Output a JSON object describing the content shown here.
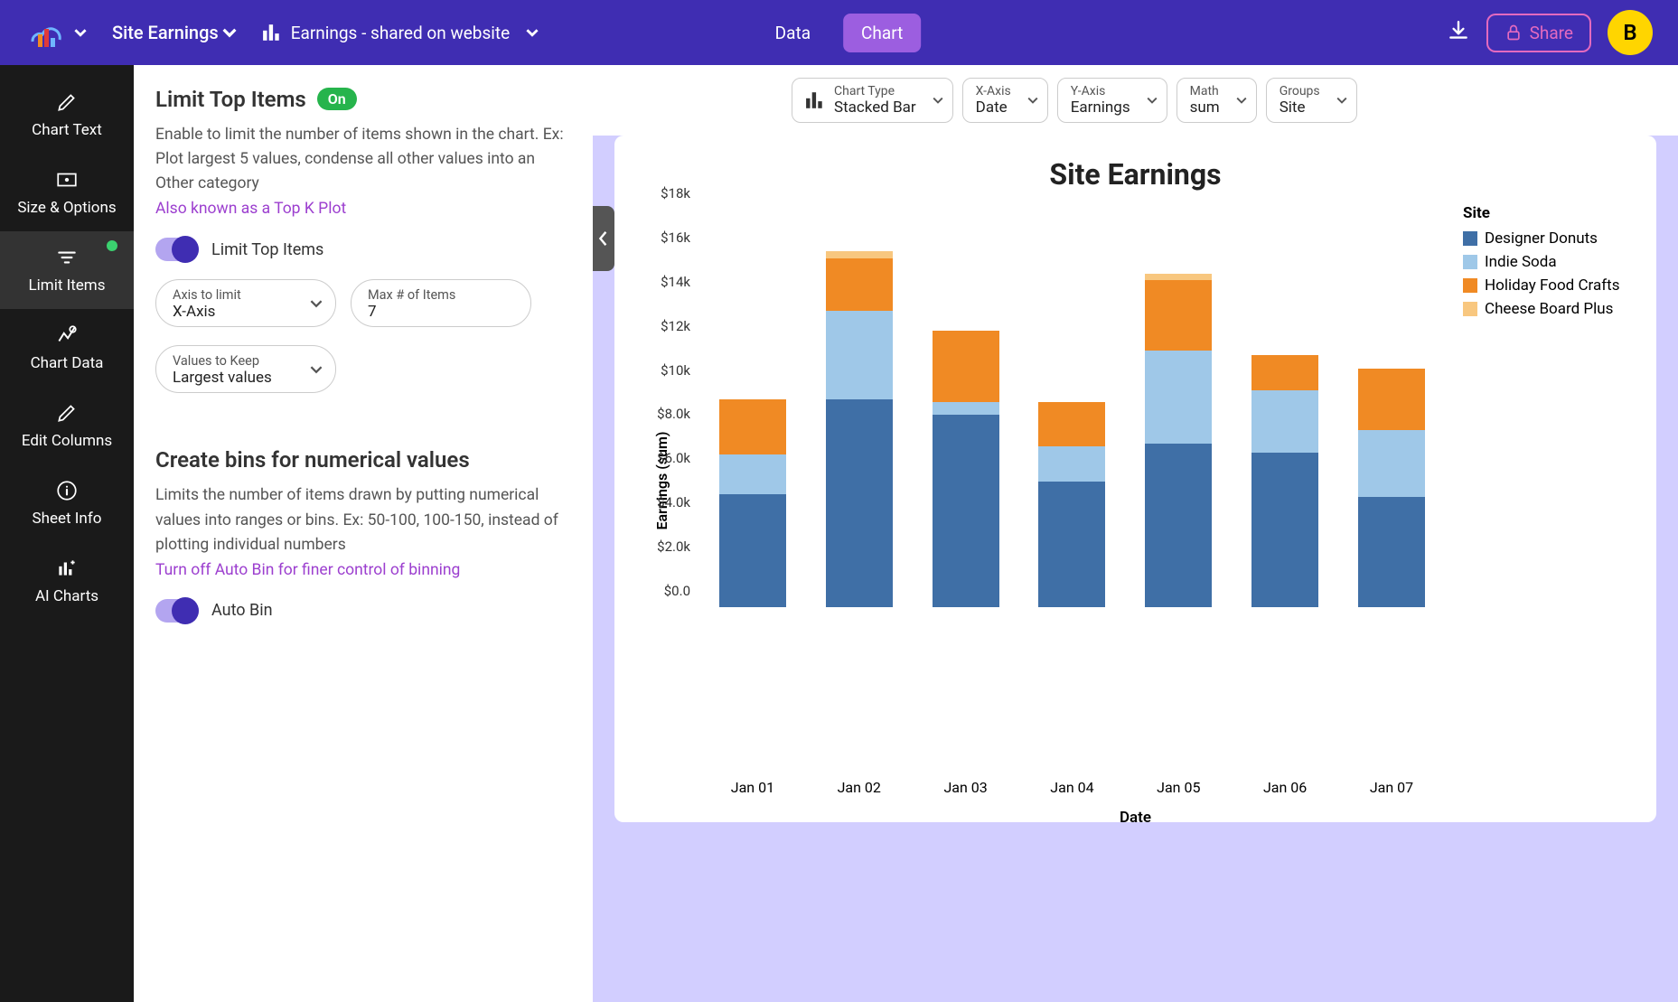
{
  "header": {
    "project_name": "Site Earnings",
    "sheet_name": "Earnings - shared on website",
    "tabs": {
      "data": "Data",
      "chart": "Chart"
    },
    "share_label": "Share",
    "avatar_initial": "B"
  },
  "sidenav": [
    {
      "id": "chart-text",
      "label": "Chart Text"
    },
    {
      "id": "size-options",
      "label": "Size & Options"
    },
    {
      "id": "limit-items",
      "label": "Limit Items",
      "active": true,
      "dot": true
    },
    {
      "id": "chart-data",
      "label": "Chart Data"
    },
    {
      "id": "edit-columns",
      "label": "Edit Columns"
    },
    {
      "id": "sheet-info",
      "label": "Sheet Info"
    },
    {
      "id": "ai-charts",
      "label": "AI Charts"
    }
  ],
  "panel": {
    "limit_top": {
      "title": "Limit Top Items",
      "badge": "On",
      "desc": "Enable to limit the number of items shown in the chart. Ex: Plot largest 5 values, condense all other values into an Other category",
      "link": "Also known as a Top K Plot",
      "toggle_label": "Limit Top Items",
      "axis_label": "Axis to limit",
      "axis_value": "X-Axis",
      "max_label": "Max # of Items",
      "max_value": "7",
      "keep_label": "Values to Keep",
      "keep_value": "Largest values"
    },
    "bins": {
      "title": "Create bins for numerical values",
      "desc": "Limits the number of items drawn by putting numerical values into ranges or bins. Ex: 50-100, 100-150, instead of plotting individual numbers",
      "link": "Turn off Auto Bin for finer control of binning",
      "toggle_label": "Auto Bin"
    }
  },
  "chart_controls": {
    "type": {
      "label": "Chart Type",
      "value": "Stacked Bar"
    },
    "x": {
      "label": "X-Axis",
      "value": "Date"
    },
    "y": {
      "label": "Y-Axis",
      "value": "Earnings"
    },
    "math": {
      "label": "Math",
      "value": "sum"
    },
    "groups": {
      "label": "Groups",
      "value": "Site"
    }
  },
  "chart_data": {
    "type": "bar",
    "stacked": true,
    "title": "Site Earnings",
    "xlabel": "Date",
    "ylabel": "Earnings (sum)",
    "ylim": [
      0,
      18000
    ],
    "yticks": [
      "$0.0",
      "$2.0k",
      "$4.0k",
      "$6.0k",
      "$8.0k",
      "$10k",
      "$12k",
      "$14k",
      "$16k",
      "$18k"
    ],
    "legend_title": "Site",
    "categories": [
      "Jan 01",
      "Jan 02",
      "Jan 03",
      "Jan 04",
      "Jan 05",
      "Jan 06",
      "Jan 07"
    ],
    "series": [
      {
        "name": "Designer Donuts",
        "color": "#3f6fa6",
        "values": [
          5100,
          9400,
          8700,
          5700,
          7400,
          7000,
          5000
        ]
      },
      {
        "name": "Indie Soda",
        "color": "#9fc8e8",
        "values": [
          1800,
          4000,
          600,
          1600,
          4200,
          2800,
          3000
        ]
      },
      {
        "name": "Holiday Food Crafts",
        "color": "#f08a24",
        "values": [
          2500,
          2400,
          3200,
          2000,
          3200,
          1600,
          2800
        ]
      },
      {
        "name": "Cheese Board Plus",
        "color": "#f8c77f",
        "values": [
          0,
          300,
          0,
          0,
          300,
          0,
          0
        ]
      }
    ]
  }
}
